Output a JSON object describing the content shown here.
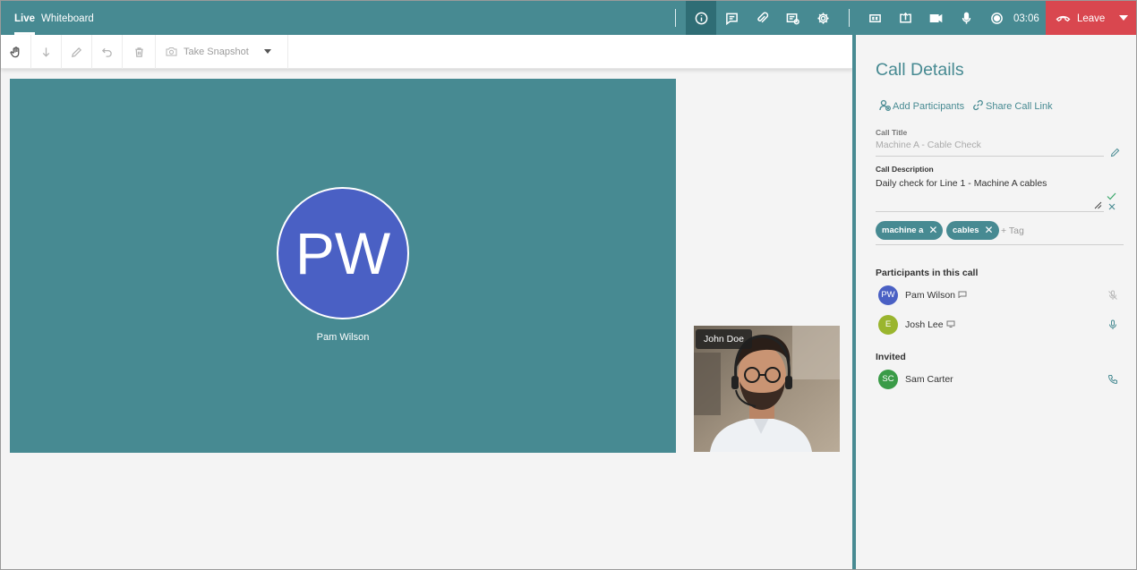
{
  "tabs": [
    {
      "label": "Live",
      "active": true
    },
    {
      "label": "Whiteboard",
      "active": false
    }
  ],
  "header": {
    "icons": [
      "info-icon",
      "chat-icon",
      "attachment-icon",
      "call-info-icon",
      "settings-icon",
      "captions-icon",
      "share-screen-icon",
      "camera-icon",
      "microphone-icon",
      "record-icon"
    ],
    "timer": "03:06",
    "leave_label": "Leave"
  },
  "toolbar": {
    "tools": [
      "hand-icon",
      "download-icon",
      "pencil-icon",
      "undo-icon",
      "trash-icon"
    ],
    "snapshot_label": "Take Snapshot"
  },
  "stage": {
    "main_initials": "PW",
    "main_name": "Pam Wilson",
    "self_name": "John Doe"
  },
  "panel": {
    "title": "Call Details",
    "add_participants": "Add Participants",
    "share_link": "Share Call Link",
    "call_title_label": "Call Title",
    "call_title_placeholder": "Machine A - Cable Check",
    "call_desc_label": "Call Description",
    "call_desc_value": "Daily check for Line 1 - Machine A cables",
    "tags": [
      "machine a",
      "cables"
    ],
    "add_tag": "+ Tag",
    "participants_heading": "Participants in this call",
    "participants": [
      {
        "initials": "PW",
        "name": "Pam Wilson",
        "color": "#4a60c4",
        "status_icon": "mic-muted-icon"
      },
      {
        "initials": "E",
        "name": "Josh Lee",
        "color": "#9ab52e",
        "status_icon": "mic-icon"
      }
    ],
    "invited_heading": "Invited",
    "invited": [
      {
        "initials": "SC",
        "name": "Sam Carter",
        "color": "#3a9b47",
        "status_icon": "phone-icon"
      }
    ]
  },
  "colors": {
    "brand": "#478a92",
    "leave": "#d9474f"
  }
}
